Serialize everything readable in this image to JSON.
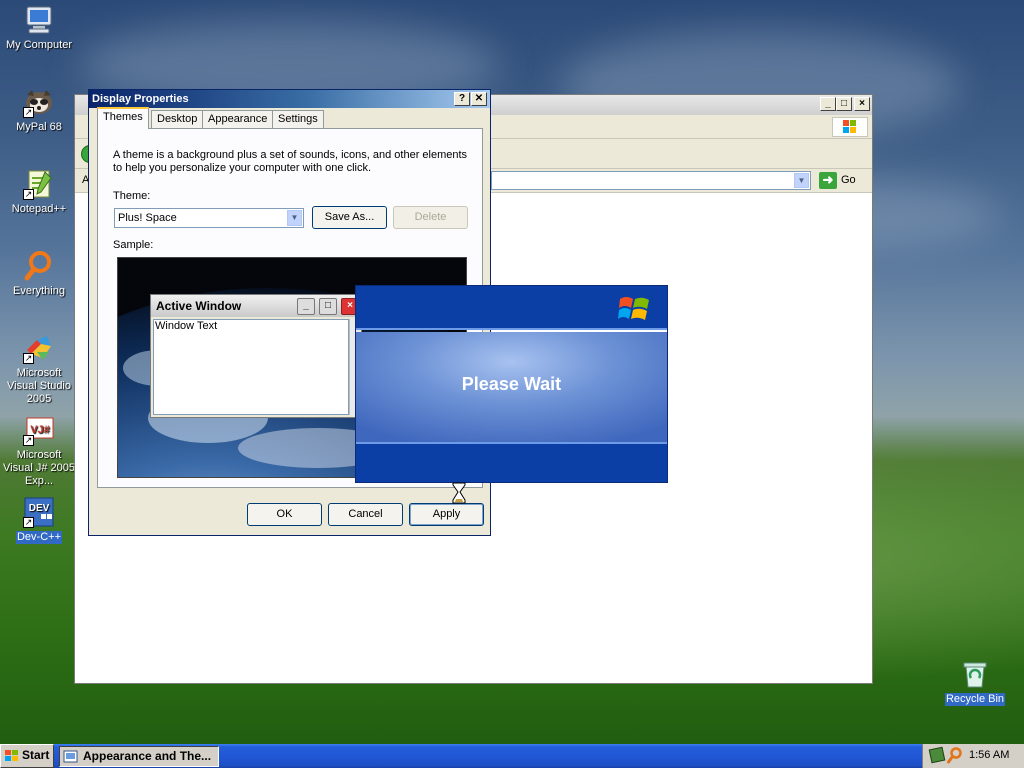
{
  "desktop": {
    "icons": [
      {
        "label": "My Computer",
        "icon": "my-computer-icon"
      },
      {
        "label": "MyPal 68",
        "icon": "mypal-icon"
      },
      {
        "label": "Notepad++",
        "icon": "notepadpp-icon"
      },
      {
        "label": "Everything",
        "icon": "everything-icon"
      },
      {
        "label": "Microsoft Visual Studio 2005",
        "icon": "visual-studio-icon"
      },
      {
        "label": "Microsoft Visual J# 2005 Exp...",
        "icon": "visual-jsharp-icon"
      },
      {
        "label": "Dev-C++",
        "icon": "dev-cpp-icon"
      },
      {
        "label": "Recycle Bin",
        "icon": "recycle-bin-icon"
      }
    ],
    "icon_texts": {
      "devcpp_badge": "DEV",
      "vj_badge": "VJ#"
    }
  },
  "background_window": {
    "address_prefix": "A",
    "go_label": "Go"
  },
  "display_properties": {
    "title": "Display Properties",
    "help_glyph": "?",
    "close_glyph": "✕",
    "tabs": [
      "Themes",
      "Desktop",
      "Appearance",
      "Settings"
    ],
    "active_tab": "Themes",
    "description": "A theme is a background plus a set of sounds, icons, and other elements to help you personalize your computer with one click.",
    "theme_label": "Theme:",
    "theme_value": "Plus! Space",
    "save_as": "Save As...",
    "delete": "Delete",
    "sample_label": "Sample:",
    "sample_active_window": "Active Window",
    "sample_window_text": "Window Text",
    "ok": "OK",
    "cancel": "Cancel",
    "apply": "Apply"
  },
  "please_wait": {
    "message": "Please Wait"
  },
  "taskbar": {
    "start_label": "Start",
    "task_label": "Appearance and The...",
    "clock": "1:56 AM"
  },
  "colors": {
    "xp_blue": "#0b3fa5",
    "selection": "#316ac5",
    "taskbar": "#245edb"
  }
}
